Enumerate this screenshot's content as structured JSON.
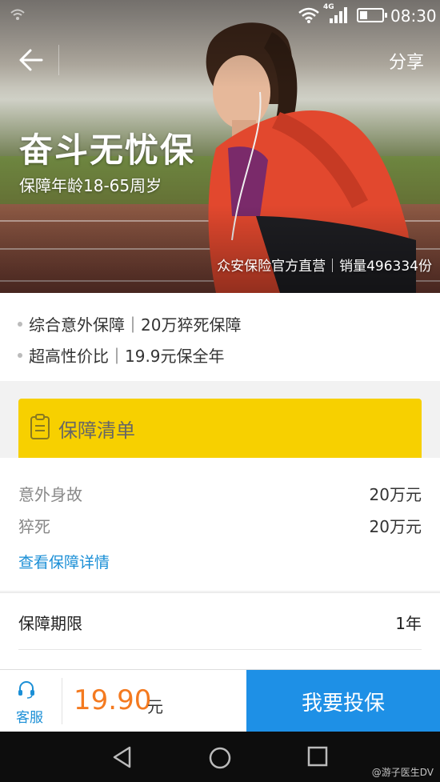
{
  "status_bar": {
    "network": "4G",
    "time": "08:30"
  },
  "header": {
    "share_label": "分享"
  },
  "hero": {
    "title": "奋斗无忧保",
    "subtitle": "保障年龄18-65周岁",
    "sales_info": "众安保险官方直营｜销量496334份"
  },
  "highlights": [
    "综合意外保障｜20万猝死保障",
    "超高性价比｜19.9元保全年"
  ],
  "coverage": {
    "banner_label": "保障清单",
    "items": [
      {
        "name": "意外身故",
        "value": "20万元"
      },
      {
        "name": "猝死",
        "value": "20万元"
      }
    ],
    "details_link": "查看保障详情",
    "term_label": "保障期限",
    "term_value": "1年"
  },
  "action_bar": {
    "service_label": "客服",
    "price": "19.90",
    "price_unit": "元",
    "buy_label": "我要投保"
  },
  "watermark": "@游子医生DV",
  "colors": {
    "accent_blue": "#1e90e6",
    "banner_yellow": "#f7d000",
    "price_orange": "#f47a20"
  }
}
